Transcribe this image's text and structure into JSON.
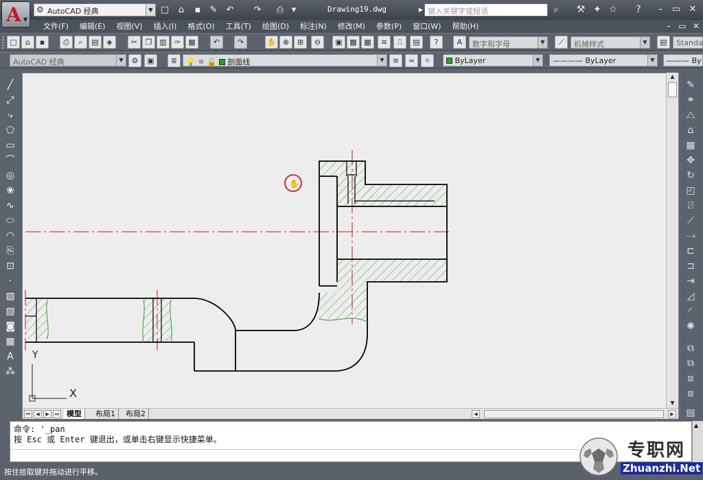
{
  "app": {
    "logo_letter": "A",
    "workspace": "AutoCAD 经典",
    "document_title": "Drawing19.dwg",
    "search_placeholder": "键入关键字或短语"
  },
  "menu": [
    "文件(F)",
    "编辑(E)",
    "视图(V)",
    "插入(I)",
    "格式(O)",
    "工具(T)",
    "绘图(D)",
    "标注(N)",
    "修改(M)",
    "参数(P)",
    "窗口(W)",
    "帮助(H)"
  ],
  "toolbar1": {
    "text_style": "数字和字母",
    "dim_style": "机械样式",
    "table_style": "Standa"
  },
  "toolbar2": {
    "workspace": "AutoCAD 经典",
    "layer": "剖面线",
    "color": "ByLayer",
    "linetype": "ByLayer",
    "lineweight": "By"
  },
  "ucs": {
    "y_label": "Y",
    "x_label": "X"
  },
  "layout_tabs": [
    "模型",
    "布局1",
    "布局2"
  ],
  "command": {
    "line1": "命令: '_pan",
    "line2": "按 Esc 或 Enter 键退出，或单击右键显示快捷菜单。"
  },
  "status": "按住拾取键并拖动进行平移。",
  "watermark": {
    "cn": "专职网",
    "en": "Zhuanzhi.Net"
  },
  "colors": {
    "hatch": "#2e9e2e",
    "centerline": "#d21414",
    "outline": "#000000",
    "cursor": "#c81e1e"
  }
}
